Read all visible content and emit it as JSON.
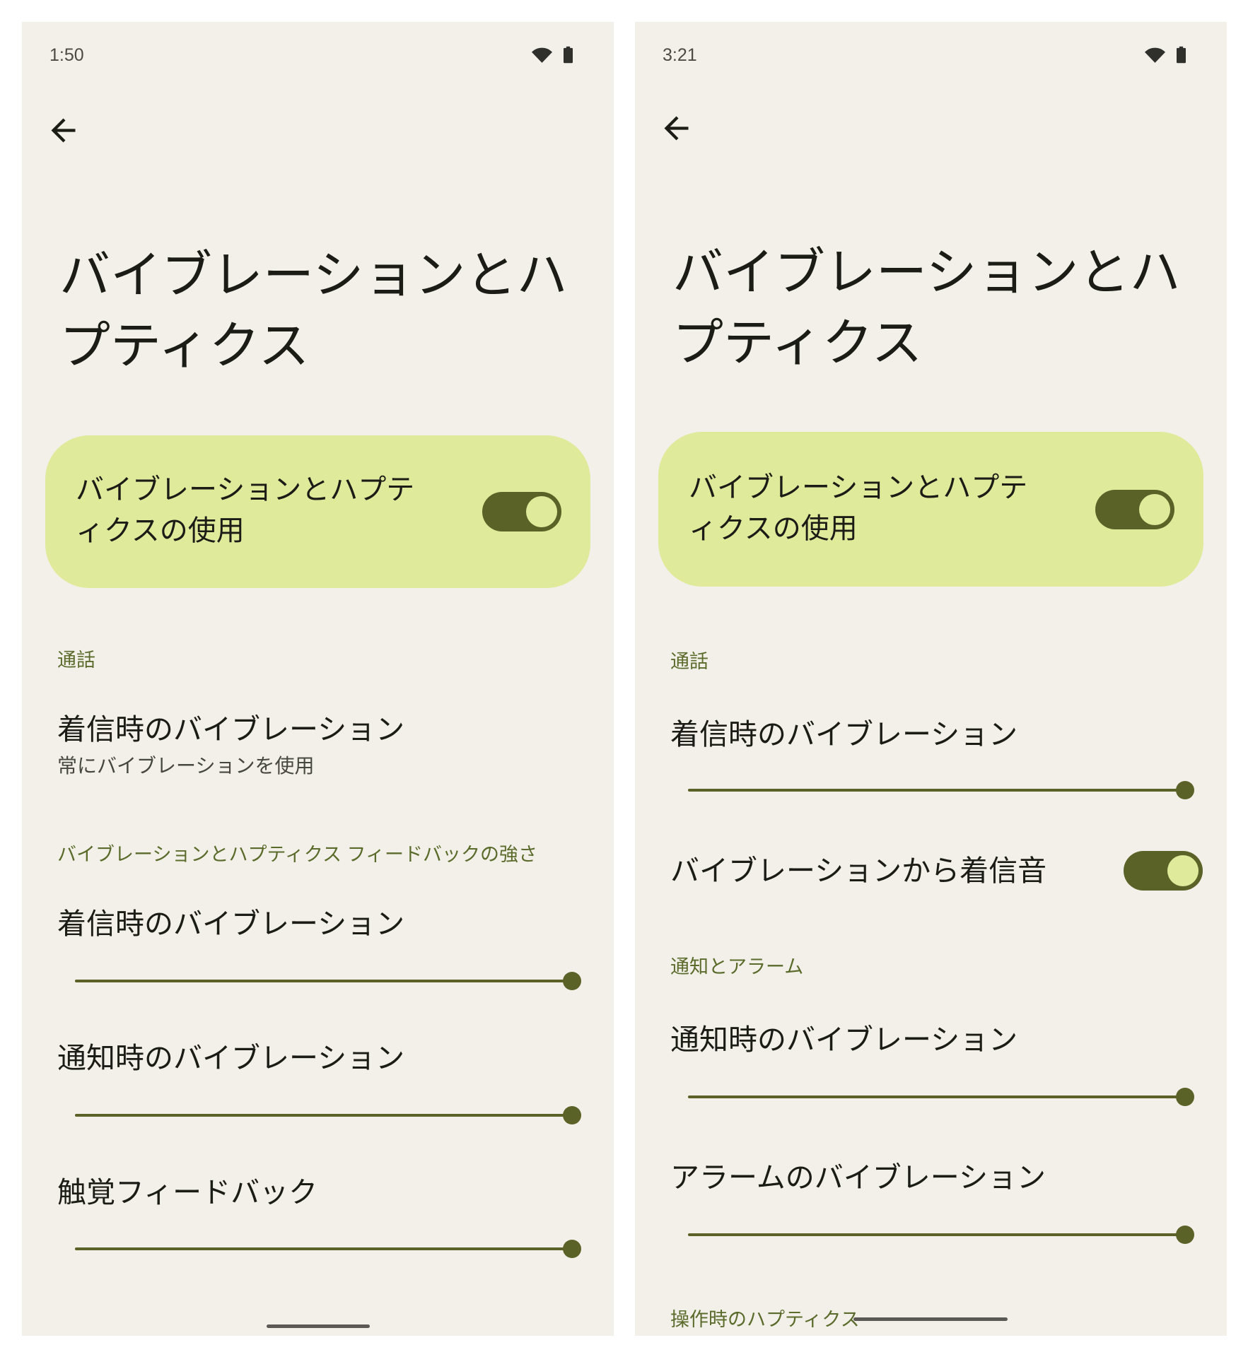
{
  "colors": {
    "page_bg": "#ffffff",
    "panel_bg": "#f2f0e9",
    "card_bg": "#dfea9b",
    "accent": "#5a6227",
    "section_header": "#5b6b2b",
    "text_primary": "#1c1c17",
    "text_secondary": "#47483d",
    "nav_handle": "#5a5955"
  },
  "screens": [
    {
      "status_bar": {
        "time": "1:50",
        "icons": [
          "wifi-icon",
          "battery-icon"
        ]
      },
      "toolbar": {
        "back_icon": "arrow-back-icon"
      },
      "title": "バイブレーションとハプティクス",
      "main_switch": {
        "label": "バイブレーションとハプティクスの使用",
        "on": true
      },
      "sections": [
        {
          "header": "通話",
          "items": [
            {
              "title": "着信時のバイブレーション",
              "summary": "常にバイブレーションを使用"
            }
          ]
        },
        {
          "header": "バイブレーションとハプティクス フィードバックの強さ",
          "items": [
            {
              "title": "着信時のバイブレーション",
              "slider_level": 1
            },
            {
              "title": "通知時のバイブレーション",
              "slider_level": 1
            },
            {
              "title": "触覚フィードバック",
              "slider_level": 1
            }
          ]
        }
      ]
    },
    {
      "status_bar": {
        "time": "3:21",
        "icons": [
          "wifi-icon",
          "battery-icon"
        ]
      },
      "toolbar": {
        "back_icon": "arrow-back-icon"
      },
      "title": "バイブレーションとハプティクス",
      "main_switch": {
        "label": "バイブレーションとハプティクスの使用",
        "on": true
      },
      "sections": [
        {
          "header": "通話",
          "items": [
            {
              "title": "着信時のバイブレーション",
              "slider_level": 1
            },
            {
              "title": "バイブレーションから着信音",
              "switch_on": true
            }
          ]
        },
        {
          "header": "通知とアラーム",
          "items": [
            {
              "title": "通知時のバイブレーション",
              "slider_level": 1
            },
            {
              "title": "アラームのバイブレーション",
              "slider_level": 1
            }
          ]
        },
        {
          "header": "操作時のハプティクス"
        }
      ]
    }
  ]
}
